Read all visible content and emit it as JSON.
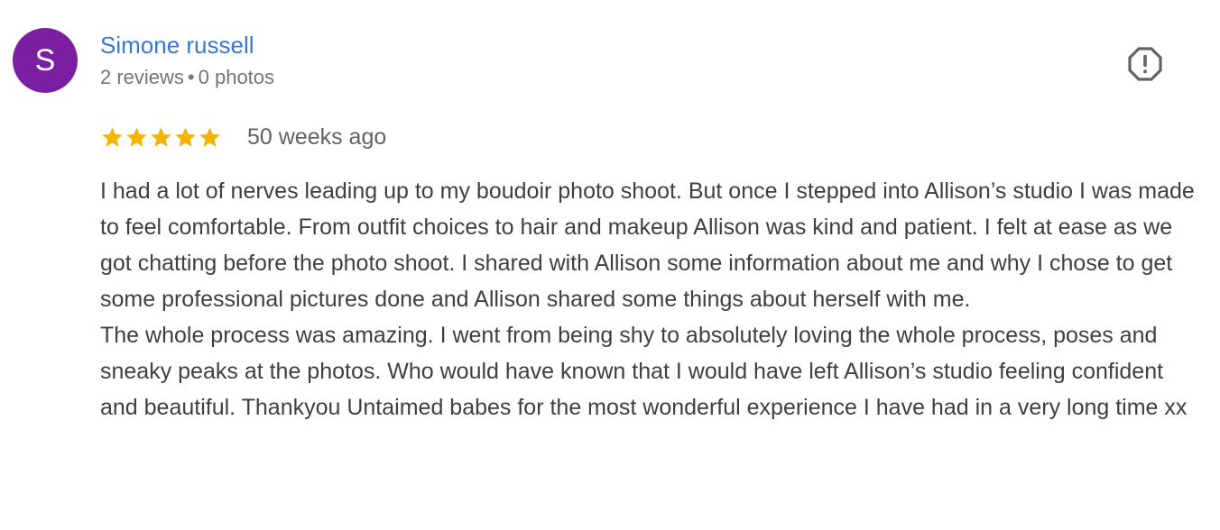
{
  "reviewer": {
    "initial": "S",
    "name": "Simone russell",
    "reviews_count": "2 reviews",
    "separator": "•",
    "photos_count": "0 photos",
    "avatar_color": "#7b1fa2"
  },
  "report": {
    "icon": "report-flag-icon"
  },
  "rating": {
    "stars": 5,
    "max": 5,
    "star_color": "#f5b400"
  },
  "date": "50 weeks ago",
  "body": {
    "paragraph_1": "I had a lot of nerves leading up to my boudoir photo shoot. But once I stepped into Allison’s studio I was made to feel comfortable. From outfit choices to hair and makeup Allison was kind and patient. I felt at ease as we got chatting before the photo shoot. I shared with Allison some information about me and why I chose to get some professional pictures done and Allison shared some things about herself with me.",
    "paragraph_2": "The whole process was amazing. I went from being shy to absolutely loving the whole process, poses and sneaky peaks at the photos. Who would have known that I would have left Allison’s studio feeling confident and beautiful. Thankyou Untaimed babes for the most wonderful experience I have had in a very long time xx"
  },
  "colors": {
    "name_link": "#3b76d6",
    "meta_text": "#70757a",
    "body_text": "#3c4043"
  }
}
